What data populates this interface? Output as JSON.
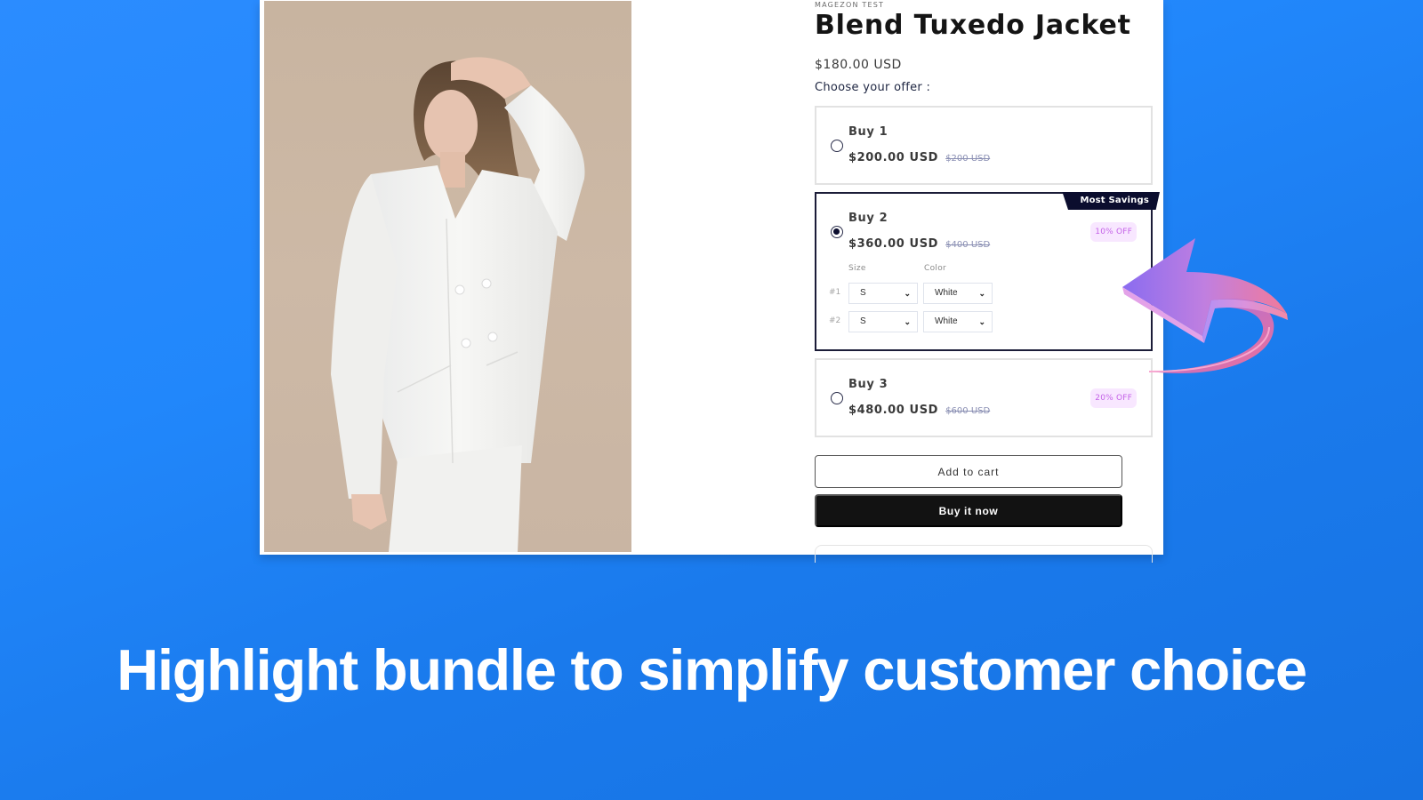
{
  "product": {
    "vendor": "MAGEZON TEST",
    "title": "Blend Tuxedo Jacket",
    "price": "$180.00 USD",
    "image_alt": "Model wearing white double-breasted tuxedo jacket"
  },
  "offer_section": {
    "prompt": "Choose your offer :",
    "offers": [
      {
        "label": "Buy 1",
        "price": "$200.00 USD",
        "compare_price": "$200 USD",
        "selected": false
      },
      {
        "label": "Buy 2",
        "price": "$360.00 USD",
        "compare_price": "$400 USD",
        "discount_badge": "10% OFF",
        "ribbon": "Most Savings",
        "selected": true,
        "variant_headers": {
          "size": "Size",
          "color": "Color"
        },
        "variants": [
          {
            "num": "#1",
            "size": "S",
            "color": "White"
          },
          {
            "num": "#2",
            "size": "S",
            "color": "White"
          }
        ]
      },
      {
        "label": "Buy 3",
        "price": "$480.00 USD",
        "compare_price": "$600 USD",
        "discount_badge": "20% OFF",
        "selected": false
      }
    ]
  },
  "actions": {
    "add_to_cart": "Add to cart",
    "buy_now": "Buy it now"
  },
  "icons": {
    "select_chevron": "⌄",
    "arrow": "curved-arrow-pointing-left"
  },
  "colors": {
    "background_light": "#2b8cff",
    "background_dark": "#1672e2",
    "selected_border": "#1b1c38",
    "ribbon_bg": "#0b0d2e",
    "badge_text": "#c462e8",
    "badge_bg": "#f8e7ff",
    "buy_button_bg": "#121212"
  },
  "headline": "Highlight bundle to simplify customer choice"
}
